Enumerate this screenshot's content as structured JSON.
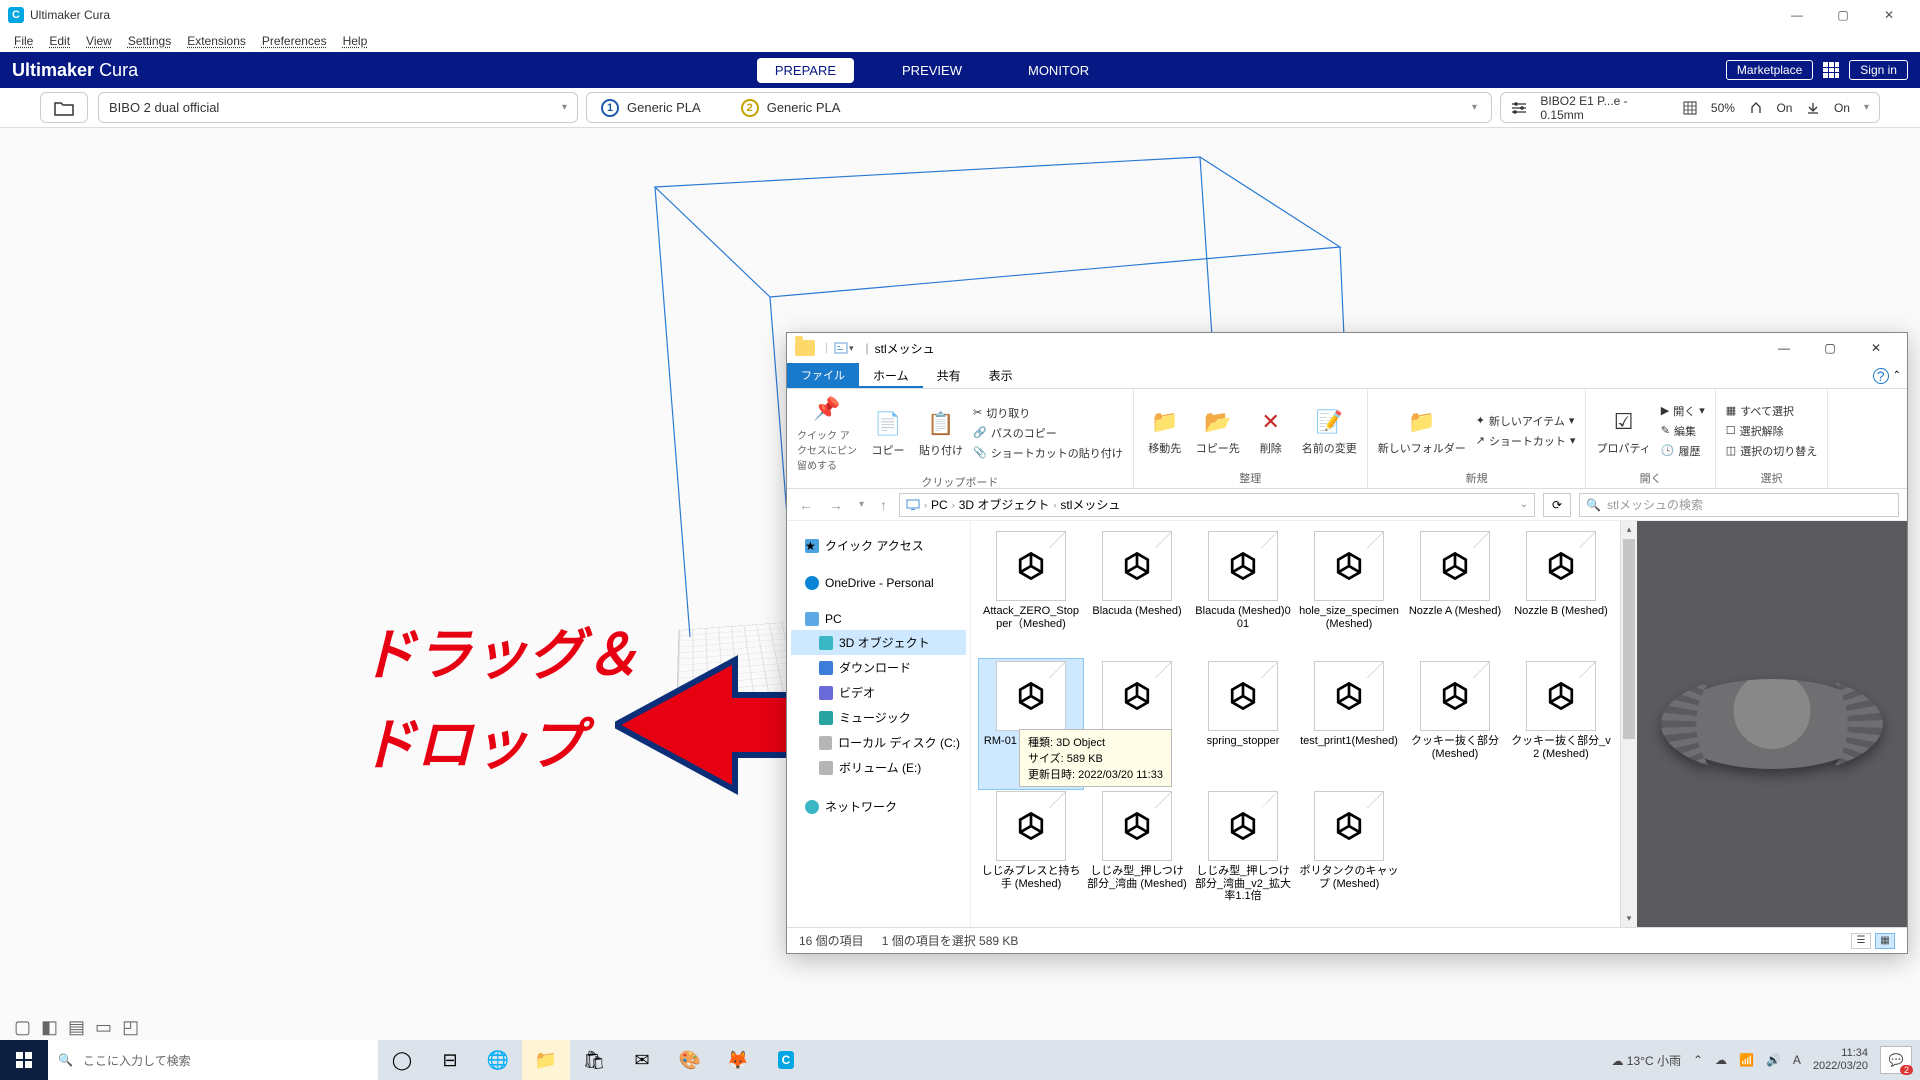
{
  "cura": {
    "title": "Ultimaker Cura",
    "menu": [
      "File",
      "Edit",
      "View",
      "Settings",
      "Extensions",
      "Preferences",
      "Help"
    ],
    "brand_bold": "Ultimaker",
    "brand_light": "Cura",
    "tabs": {
      "prepare": "PREPARE",
      "preview": "PREVIEW",
      "monitor": "MONITOR"
    },
    "marketplace": "Marketplace",
    "signin": "Sign in",
    "printer": "BIBO 2 dual official",
    "extruder1": "Generic PLA",
    "extruder2": "Generic PLA",
    "profile": "BIBO2 E1 P...e - 0.15mm",
    "infill": "50%",
    "support": "On",
    "adhesion": "On"
  },
  "annotation": {
    "line1": "ドラッグ＆",
    "line2": "ドロップ"
  },
  "explorer": {
    "title": "stlメッシュ",
    "tabs": {
      "file": "ファイル",
      "home": "ホーム",
      "share": "共有",
      "view": "表示"
    },
    "ribbon": {
      "pin": "クイック アクセスにピン留めする",
      "copy": "コピー",
      "paste": "貼り付け",
      "cut": "切り取り",
      "copypath": "パスのコピー",
      "paste_shortcut": "ショートカットの貼り付け",
      "clipboard": "クリップボード",
      "moveto": "移動先",
      "copyto": "コピー先",
      "delete": "削除",
      "rename": "名前の変更",
      "organize": "整理",
      "newfolder": "新しいフォルダー",
      "newitem": "新しいアイテム",
      "shortcut": "ショートカット",
      "new": "新規",
      "properties": "プロパティ",
      "open": "開く",
      "edit": "編集",
      "history": "履歴",
      "open_grp": "開く",
      "selectall": "すべて選択",
      "selectnone": "選択解除",
      "invert": "選択の切り替え",
      "select": "選択"
    },
    "breadcrumbs": [
      "PC",
      "3D オブジェクト",
      "stlメッシュ"
    ],
    "search_placeholder": "stlメッシュの検索",
    "nav": {
      "quick": "クイック アクセス",
      "onedrive": "OneDrive - Personal",
      "pc": "PC",
      "3dobj": "3D オブジェクト",
      "downloads": "ダウンロード",
      "videos": "ビデオ",
      "music": "ミュージック",
      "localc": "ローカル ディスク (C:)",
      "vole": "ボリューム (E:)",
      "network": "ネットワーク"
    },
    "files": [
      "Attack_ZERO_Stopper（Meshed)",
      "Blacuda (Meshed)",
      "Blacuda (Meshed)001",
      "hole_size_specimen (Meshed)",
      "Nozzle A (Meshed)",
      "Nozzle B (Meshed)",
      "RM-01\nGear (Meshed)",
      "",
      "spring_stopper",
      "test_print1(Meshed)",
      "クッキー抜く部分 (Meshed)",
      "クッキー抜く部分_v2 (Meshed)",
      "しじみプレスと持ち手 (Meshed)",
      "しじみ型_押しつけ部分_湾曲 (Meshed)",
      "しじみ型_押しつけ部分_湾曲_v2_拡大率1.1倍",
      "ポリタンクのキャップ (Meshed)"
    ],
    "tooltip": {
      "kind": "種類: 3D Object",
      "size": "サイズ: 589 KB",
      "date": "更新日時: 2022/03/20 11:33"
    },
    "status": {
      "count": "16 個の項目",
      "sel": "1 個の項目を選択 589 KB"
    }
  },
  "taskbar": {
    "search": "ここに入力して検索",
    "weather": "13°C  小雨",
    "ime": "A",
    "time": "11:34",
    "date": "2022/03/20",
    "notif_count": "2"
  }
}
